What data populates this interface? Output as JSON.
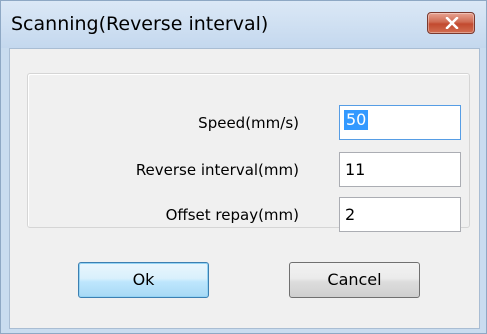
{
  "dialog": {
    "title": "Scanning(Reverse interval)",
    "close_icon": "close-x-icon",
    "accent_color": "#c24a2f"
  },
  "fields": {
    "speed": {
      "label": "Speed(mm/s)",
      "value": "50"
    },
    "reverse_interval": {
      "label": "Reverse interval(mm)",
      "value": "11"
    },
    "offset_repay": {
      "label": "Offset repay(mm)",
      "value": "2"
    }
  },
  "buttons": {
    "ok_label": "Ok",
    "cancel_label": "Cancel"
  }
}
